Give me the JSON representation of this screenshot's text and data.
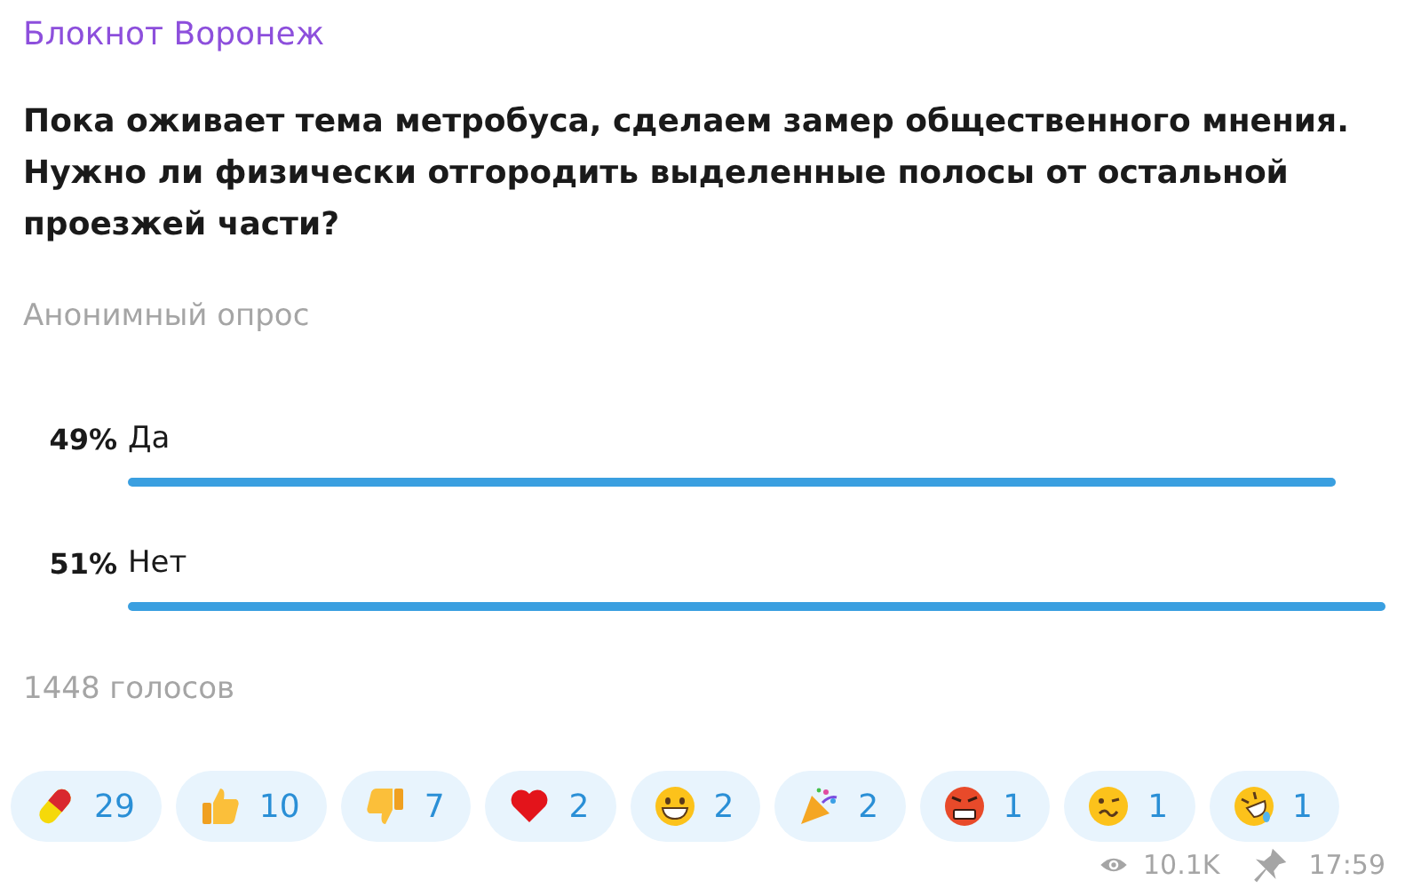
{
  "channel": {
    "name": "Блокнот Воронеж"
  },
  "poll": {
    "question": "Пока оживает тема метробуса, сделаем замер общественного мнения. Нужно ли физически отгородить выделенные полосы от остальной проезжей части?",
    "type": "Анонимный опрос",
    "options": [
      {
        "percent": "49%",
        "label": "Да"
      },
      {
        "percent": "51%",
        "label": "Нет"
      }
    ],
    "votes": "1448 голосов"
  },
  "reactions": [
    {
      "kind": "pill",
      "count": "29"
    },
    {
      "kind": "thumbs-up",
      "count": "10"
    },
    {
      "kind": "thumbs-down",
      "count": "7"
    },
    {
      "kind": "heart",
      "count": "2"
    },
    {
      "kind": "grin",
      "count": "2"
    },
    {
      "kind": "party",
      "count": "2"
    },
    {
      "kind": "angry",
      "count": "1"
    },
    {
      "kind": "woozy",
      "count": "1"
    },
    {
      "kind": "rofl",
      "count": "1"
    }
  ],
  "footer": {
    "views": "10.1K",
    "time": "17:59"
  }
}
